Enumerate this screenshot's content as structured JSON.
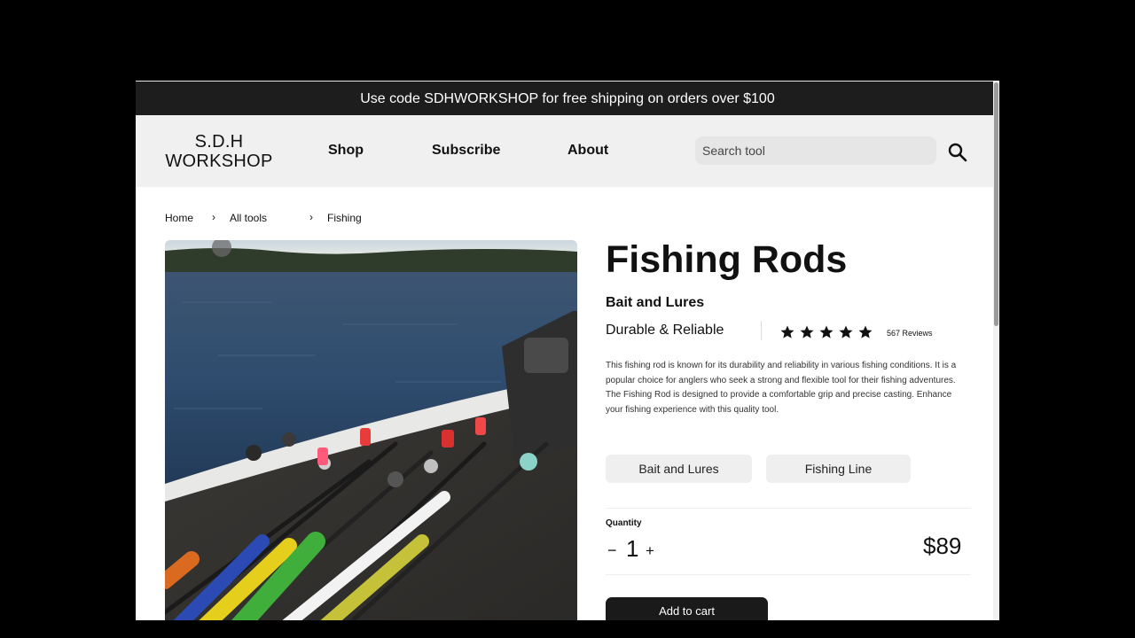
{
  "promo": {
    "text": "Use code SDHWORKSHOP for free shipping on orders over $100"
  },
  "header": {
    "logo_line1": "S.D.H",
    "logo_line2": "WORKSHOP",
    "nav": [
      "Shop",
      "Subscribe",
      "About"
    ],
    "search_placeholder": "Search tool",
    "search_icon": "search-icon"
  },
  "breadcrumb": {
    "items": [
      "Home",
      "All tools",
      "Fishing"
    ],
    "separator": "›"
  },
  "product": {
    "title": "Fishing Rods",
    "category": "Bait and Lures",
    "tagline": "Durable & Reliable",
    "rating": 5,
    "rating_max": 5,
    "reviews": "567 Reviews",
    "description": "This fishing rod is known for its durability and reliability in various fishing conditions. It is a popular choice for anglers who seek a strong and flexible tool for their fishing adventures. The Fishing Rod is designed to provide a comfortable grip and precise casting. Enhance your fishing experience with this quality tool.",
    "tags": [
      "Bait and Lures",
      "Fishing Line"
    ],
    "quantity_label": "Quantity",
    "quantity_minus": "−",
    "quantity": "1",
    "quantity_plus": "+",
    "price": "$89",
    "add_to_cart": "Add to cart",
    "image": "fishing-rods-on-boat-photo"
  },
  "colors": {
    "promo_bg": "#1d1d1d",
    "header_bg": "#f0f0f0",
    "button_bg": "#1a1a1a",
    "chip_bg": "#efefef"
  }
}
